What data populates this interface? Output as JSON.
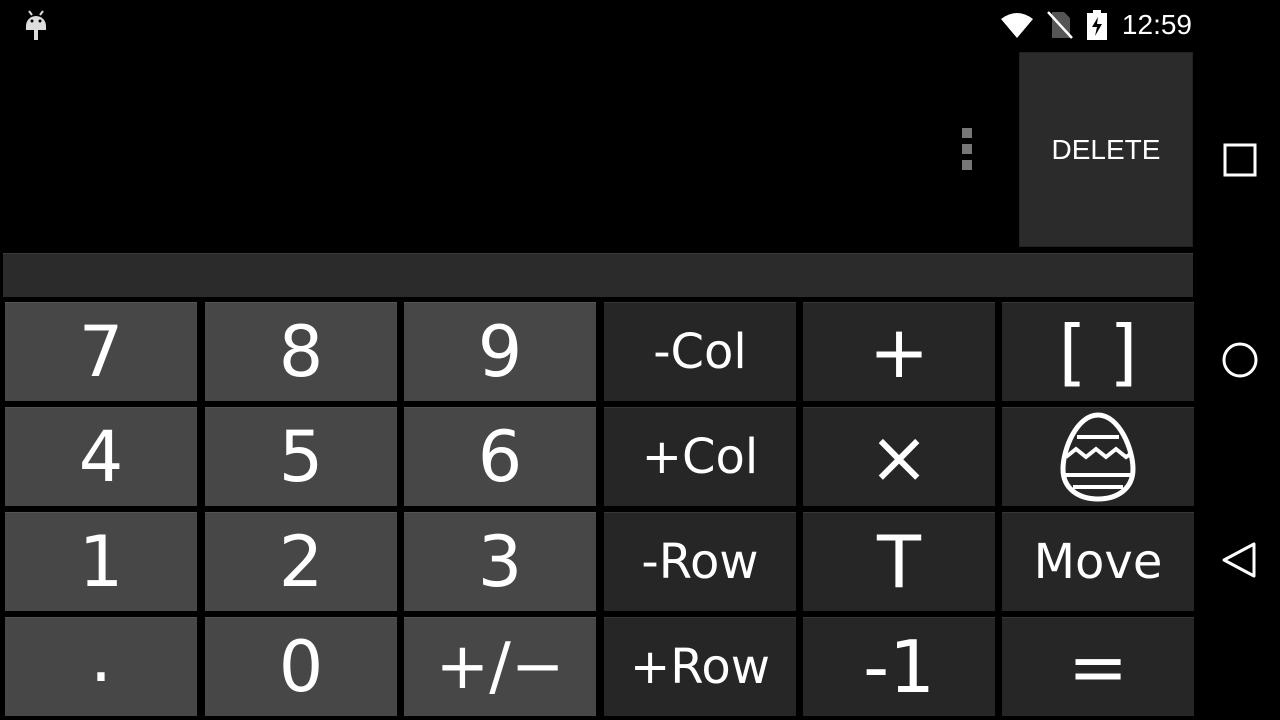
{
  "status_bar": {
    "time": "12:59",
    "icons": [
      "android-notification-icon",
      "wifi-icon",
      "no-sim-icon",
      "battery-charging-icon"
    ]
  },
  "display": {
    "delete_label": "DELETE",
    "overflow_icon": "more-vertical-icon"
  },
  "keypad": {
    "rows": [
      [
        "7",
        "8",
        "9",
        "-Col",
        "+",
        "[ ]"
      ],
      [
        "4",
        "5",
        "6",
        "+Col",
        "×",
        "egg-icon"
      ],
      [
        "1",
        "2",
        "3",
        "-Row",
        "T",
        "Move"
      ],
      [
        ".",
        "0",
        "+/−",
        "+Row",
        "-1",
        "="
      ]
    ]
  },
  "nav_bar": {
    "icons": [
      "recents-square-icon",
      "home-circle-icon",
      "back-triangle-icon"
    ]
  },
  "colors": {
    "background": "#000000",
    "number_key": "#474747",
    "operator_key": "#262626",
    "delete_key": "#2b2b2b"
  }
}
